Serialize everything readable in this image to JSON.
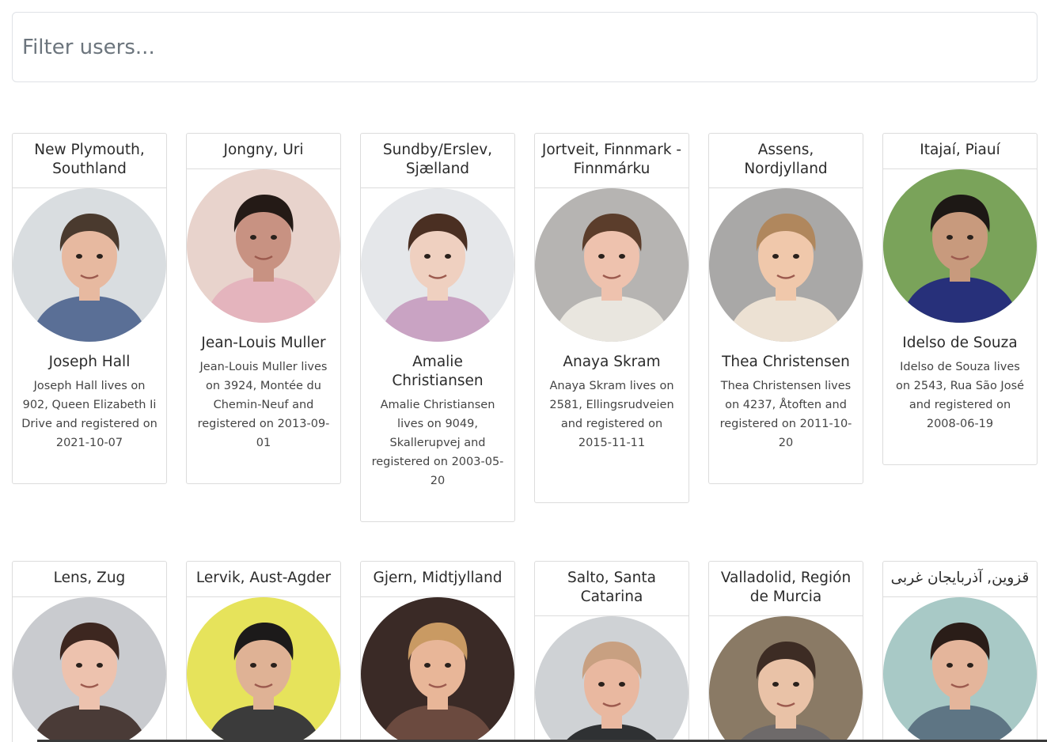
{
  "search": {
    "placeholder": "Filter users..."
  },
  "users": [
    {
      "location": "New Plymouth, Southland",
      "name": "Joseph Hall",
      "bio": "Joseph Hall lives on 902, Queen Elizabeth Ii Drive and registered on 2021-10-07",
      "avatar": {
        "bg": "#d9dde0",
        "hair": "#4a3a2e",
        "skin": "#e7b9a0",
        "shirt": "#5a6f96"
      }
    },
    {
      "location": "Jongny, Uri",
      "name": "Jean-Louis Muller",
      "bio": "Jean-Louis Muller lives on 3924, Montée du Chemin-Neuf and registered on 2013-09-01",
      "avatar": {
        "bg": "#e8d3cc",
        "hair": "#241a16",
        "skin": "#c89282",
        "shirt": "#e4b4bd"
      }
    },
    {
      "location": "Sundby/Erslev, Sjælland",
      "name": "Amalie Christiansen",
      "bio": "Amalie Christiansen lives on 9049, Skallerupvej and registered on 2003-05-20",
      "avatar": {
        "bg": "#e5e7ea",
        "hair": "#4a2f22",
        "skin": "#efd0c0",
        "shirt": "#c9a3c3"
      }
    },
    {
      "location": "Jortveit, Finnmark - Finnmárku",
      "name": "Anaya Skram",
      "bio": "Anaya Skram lives on 2581, Ellingsrudveien and registered on 2015-11-11",
      "avatar": {
        "bg": "#b6b4b2",
        "hair": "#5b3d2b",
        "skin": "#eec2ae",
        "shirt": "#e9e6df"
      }
    },
    {
      "location": "Assens, Nordjylland",
      "name": "Thea Christensen",
      "bio": "Thea Christensen lives on 4237, Åtoften and registered on 2011-10-20",
      "avatar": {
        "bg": "#a9a8a7",
        "hair": "#b0875d",
        "skin": "#f0c8ab",
        "shirt": "#ece1d3"
      }
    },
    {
      "location": "Itajaí, Piauí",
      "name": "Idelso de Souza",
      "bio": "Idelso de Souza lives on 2543, Rua São José and registered on 2008-06-19",
      "avatar": {
        "bg": "#7aa35a",
        "hair": "#1d1815",
        "skin": "#c89a7d",
        "shirt": "#27307a"
      }
    },
    {
      "location": "Lens, Zug",
      "name": "",
      "bio": "",
      "avatar": {
        "bg": "#c9cbcf",
        "hair": "#3d2720",
        "skin": "#edc2ae",
        "shirt": "#4a3b37"
      }
    },
    {
      "location": "Lervik, Aust-Agder",
      "name": "",
      "bio": "",
      "avatar": {
        "bg": "#e6e35b",
        "hair": "#1c1a1a",
        "skin": "#dfb295",
        "shirt": "#3b3b3b"
      }
    },
    {
      "location": "Gjern, Midtjylland",
      "name": "",
      "bio": "",
      "avatar": {
        "bg": "#3a2a26",
        "hair": "#c99a63",
        "skin": "#e8b698",
        "shirt": "#6b4a3f"
      }
    },
    {
      "location": "Salto, Santa Catarina",
      "name": "",
      "bio": "",
      "avatar": {
        "bg": "#cfd2d5",
        "hair": "#c8a081",
        "skin": "#e9b8a0",
        "shirt": "#2f3133"
      }
    },
    {
      "location": "Valladolid, Región de Murcia",
      "name": "",
      "bio": "",
      "avatar": {
        "bg": "#8a7a65",
        "hair": "#3d2c24",
        "skin": "#e9c2a7",
        "shirt": "#6e6a6a"
      }
    },
    {
      "location": "قزوین, آذربایجان غربی",
      "name": "",
      "bio": "",
      "avatar": {
        "bg": "#a8c9c6",
        "hair": "#2a1d18",
        "skin": "#e4b59b",
        "shirt": "#5e7584"
      }
    }
  ]
}
